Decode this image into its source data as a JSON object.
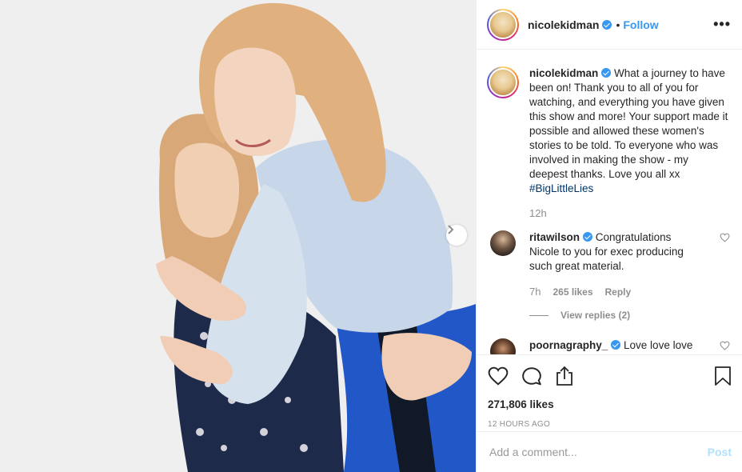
{
  "post": {
    "image_alt": "Two women hugging"
  },
  "header": {
    "username": "nicolekidman",
    "separator": "•",
    "follow_label": "Follow",
    "more_label": "•••"
  },
  "caption": {
    "username": "nicolekidman",
    "text": "What a journey to have been on! Thank you to all of you for watching, and everything you have given this show and more! Your support made it possible and allowed these women's stories to be told. To everyone who was involved in making the show - my deepest thanks. Love you all xx",
    "hashtag": "#BigLittleLies",
    "time": "12h"
  },
  "comments": [
    {
      "username": "ritawilson",
      "text": "Congratulations Nicole to you for exec producing such great material.",
      "time": "7h",
      "likes": "265 likes",
      "reply_label": "Reply",
      "view_replies": "View replies (2)"
    },
    {
      "username": "poornagraphy_",
      "text": "Love love love"
    }
  ],
  "actions": {
    "likes": "271,806 likes",
    "time_ago": "12 HOURS AGO"
  },
  "add_comment": {
    "placeholder": "Add a comment...",
    "post_label": "Post"
  },
  "colors": {
    "accent": "#3897f0",
    "hashtag": "#003569",
    "muted": "#8e8e8e",
    "post_disabled": "#b2dffc"
  },
  "icons": {
    "heart": "heart-icon",
    "comment": "comment-icon",
    "share": "share-icon",
    "save": "bookmark-icon",
    "next": "chevron-right-icon",
    "verified": "verified-badge-icon"
  }
}
